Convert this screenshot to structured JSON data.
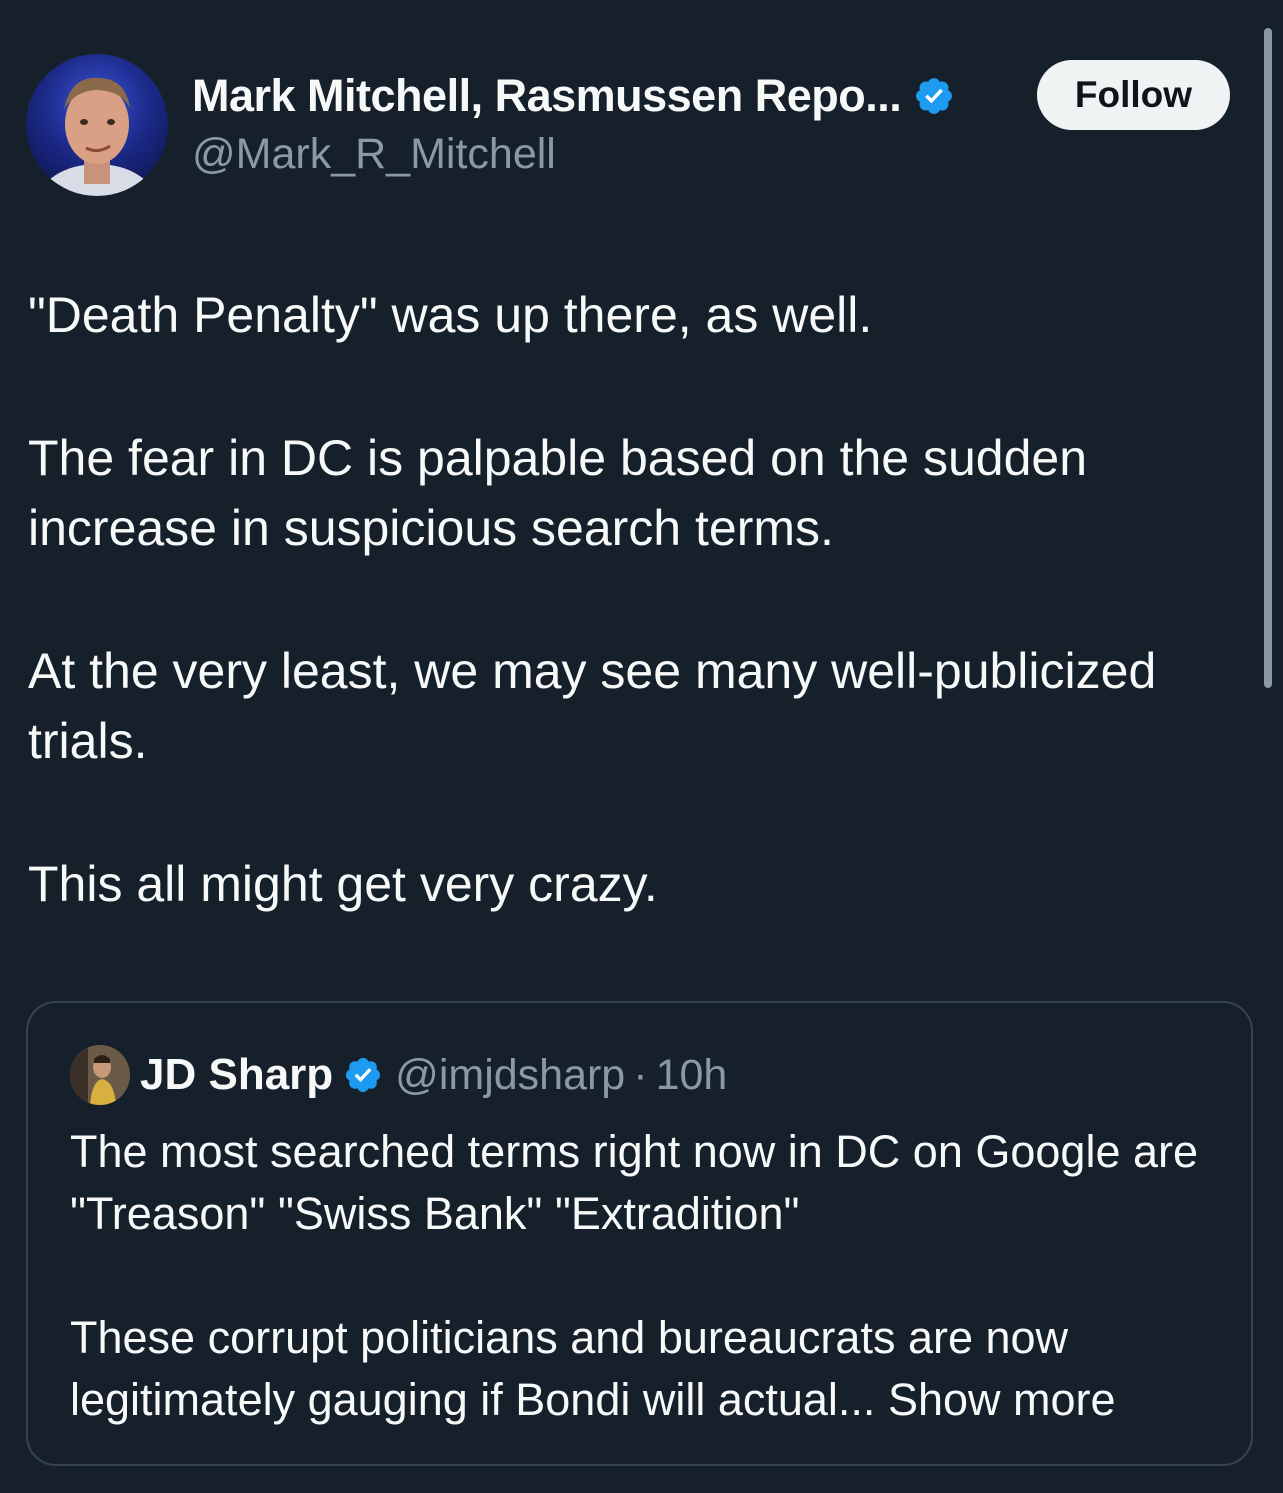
{
  "author": {
    "name": "Mark Mitchell, Rasmussen Repo...",
    "handle": "@Mark_R_Mitchell",
    "verified_color": "#1d9bf0"
  },
  "follow_button": {
    "label": "Follow"
  },
  "tweet": {
    "paragraphs": [
      "\"Death Penalty\" was up there, as well.",
      "The fear in DC is palpable based on the sudden increase in suspicious search terms.",
      "At the very least, we may see many well-publicized trials.",
      "This all might get very crazy."
    ]
  },
  "quoted_tweet": {
    "name": "JD Sharp",
    "handle": "@imjdsharp",
    "separator": "·",
    "time": "10h",
    "paragraphs": [
      "The most searched terms right now in DC on Google are \"Treason\" \"Swiss Bank\" \"Extradition\"",
      "These corrupt politicians and bureaucrats are now legitimately gauging if Bondi will actual..."
    ],
    "show_more_label": "Show more"
  },
  "colors": {
    "background": "#15202b",
    "text_primary": "#f7f9f9",
    "text_secondary": "#8b98a5",
    "border": "#38444d"
  }
}
